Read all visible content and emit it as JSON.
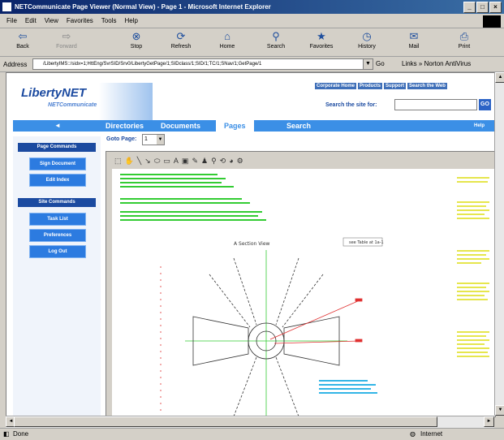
{
  "window": {
    "title": "NETCommunicate Page Viewer (Normal View) - Page 1 - Microsoft Internet Explorer",
    "controls": [
      "_",
      "□",
      "×"
    ]
  },
  "menu": [
    "File",
    "Edit",
    "View",
    "Favorites",
    "Tools",
    "Help"
  ],
  "toolbar": [
    {
      "label": "Back",
      "icon": "back-arrow-icon"
    },
    {
      "label": "Forward",
      "icon": "forward-arrow-icon"
    },
    {
      "label": "Stop",
      "icon": "stop-icon"
    },
    {
      "label": "Refresh",
      "icon": "refresh-icon"
    },
    {
      "label": "Home",
      "icon": "home-icon"
    },
    {
      "label": "Search",
      "icon": "search-icon"
    },
    {
      "label": "Favorites",
      "icon": "favorites-icon"
    },
    {
      "label": "History",
      "icon": "history-icon"
    },
    {
      "label": "Mail",
      "icon": "mail-icon"
    },
    {
      "label": "Print",
      "icon": "print-icon"
    }
  ],
  "address": {
    "label": "Address",
    "url": "/LibertyIMS::/sidx=1;HttEng/SvrSID/Srv0/LibertyGetPage/1;SIDclass/1;SID/1;TC/1;SNav/1;GetPage/1",
    "go": "Go",
    "links": "Links",
    "links_item": "Norton AntiVirus"
  },
  "page": {
    "logo_main": "LibertyNET",
    "logo_sub": "NETCommunicate",
    "top_links": [
      "Corporate Home",
      "Products",
      "Support",
      "Search the Web"
    ],
    "search_label": "Search the site for:",
    "search_go": "GO",
    "nav_arrow": "◄",
    "nav_tabs": [
      "Directories",
      "Documents",
      "Pages",
      "Search"
    ],
    "nav_active": "Pages",
    "help": "Help",
    "goto_label": "Goto Page:",
    "goto_value": "1",
    "page_commands_header": "Page Commands",
    "page_commands": [
      "Sign Document",
      "Edit Index"
    ],
    "site_commands_header": "Site Commands",
    "site_commands": [
      "Task List",
      "Preferences",
      "Log Out"
    ]
  },
  "drawing": {
    "title_left": "A Section View",
    "title_right": "see Table at 1a-1"
  },
  "status": {
    "left": "Done",
    "right": "Internet"
  }
}
